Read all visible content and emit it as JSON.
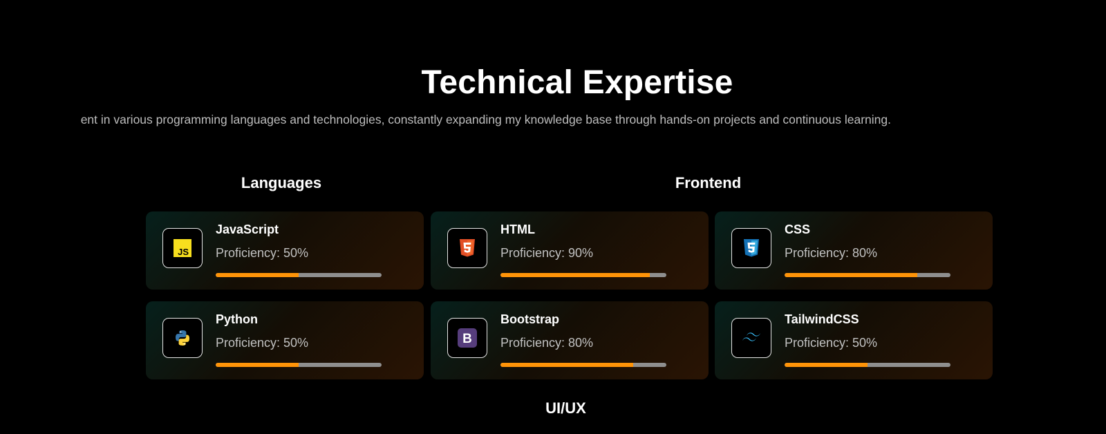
{
  "heading": "Technical Expertise",
  "subtitle": "ent in various programming languages and technologies, constantly expanding my knowledge base through hands-on projects and continuous learning.",
  "categories": [
    {
      "title": "Languages"
    },
    {
      "title": "Frontend"
    },
    {
      "title": "UI/UX"
    }
  ],
  "skills": [
    {
      "name": "JavaScript",
      "proficiency_text": "Proficiency: 50%",
      "proficiency": 50,
      "icon": "javascript-icon"
    },
    {
      "name": "HTML",
      "proficiency_text": "Proficiency: 90%",
      "proficiency": 90,
      "icon": "html5-icon"
    },
    {
      "name": "CSS",
      "proficiency_text": "Proficiency: 80%",
      "proficiency": 80,
      "icon": "css3-icon"
    },
    {
      "name": "Python",
      "proficiency_text": "Proficiency: 50%",
      "proficiency": 50,
      "icon": "python-icon"
    },
    {
      "name": "Bootstrap",
      "proficiency_text": "Proficiency: 80%",
      "proficiency": 80,
      "icon": "bootstrap-icon"
    },
    {
      "name": "TailwindCSS",
      "proficiency_text": "Proficiency: 50%",
      "proficiency": 50,
      "icon": "tailwindcss-icon"
    }
  ],
  "colors": {
    "background": "#000000",
    "bar_fill": "#ff9408",
    "bar_track": "#8f8f8f"
  }
}
